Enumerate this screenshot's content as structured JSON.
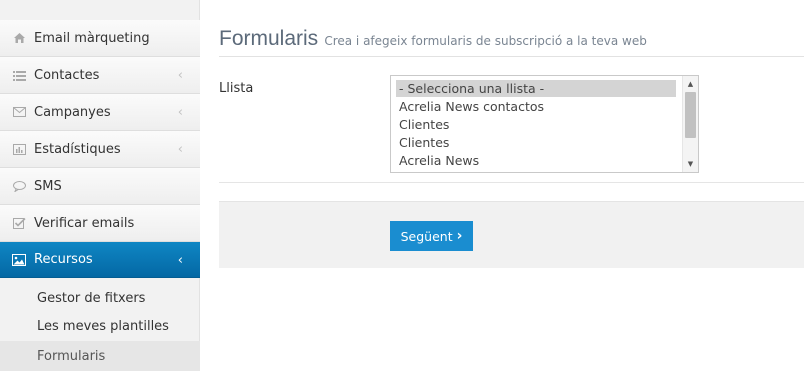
{
  "sidebar": {
    "items": [
      {
        "label": "Email màrqueting",
        "icon": "home-icon"
      },
      {
        "label": "Contactes",
        "icon": "list-icon",
        "chevron": "‹"
      },
      {
        "label": "Campanyes",
        "icon": "envelope-icon",
        "chevron": "‹"
      },
      {
        "label": "Estadístiques",
        "icon": "bar-chart-icon",
        "chevron": "‹"
      },
      {
        "label": "SMS",
        "icon": "speech-bubble-icon"
      },
      {
        "label": "Verificar emails",
        "icon": "checkbox-icon"
      },
      {
        "label": "Recursos",
        "icon": "image-icon",
        "chevron": "‹",
        "active": true
      }
    ],
    "subitems": [
      {
        "label": "Gestor de fitxers"
      },
      {
        "label": "Les meves plantilles"
      },
      {
        "label": "Formularis",
        "selected": true
      }
    ]
  },
  "main": {
    "title": "Formularis",
    "subtitle": "Crea i afegeix formularis de subscripció a la teva web",
    "list_label": "Llista",
    "list_options": [
      "- Selecciona una llista -",
      "Acrelia News contactos",
      "Clientes",
      "Clientes",
      "Acrelia News"
    ],
    "selected_option": "- Selecciona una llista -",
    "next_button": "Següent",
    "next_arrow": "›"
  },
  "colors": {
    "accent": "#0a7ab8",
    "button": "#1a8dd0",
    "sidebar_bg": "#f2f2f2"
  }
}
